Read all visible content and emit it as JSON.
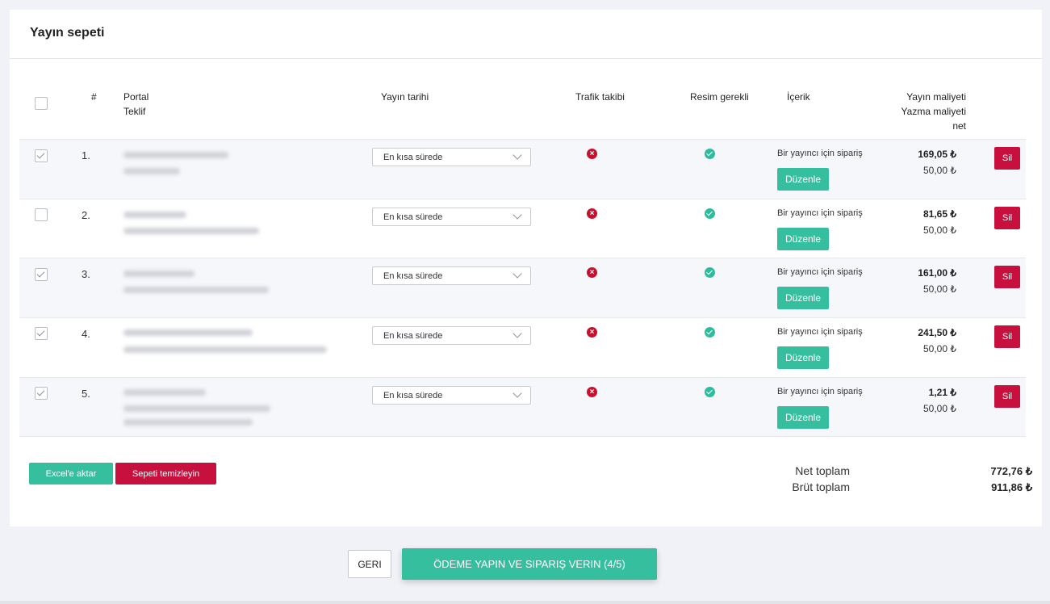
{
  "card": {
    "title": "Yayın sepeti"
  },
  "headers": {
    "number": "#",
    "portal": "Portal",
    "offer": "Teklif",
    "publish_date": "Yayın tarihi",
    "traffic": "Trafik takibi",
    "image": "Resim gerekli",
    "content": "İçerik",
    "publish_cost": "Yayın maliyeti",
    "write_cost": "Yazma maliyeti",
    "net": "net"
  },
  "rows": [
    {
      "num": "1.",
      "checked": true,
      "date": "En kısa sürede",
      "content": "Bir yayıncı için sipariş",
      "edit": "Düzenle",
      "price": "169,05 ₺",
      "write": "50,00 ₺",
      "delete": "Sil"
    },
    {
      "num": "2.",
      "checked": false,
      "date": "En kısa sürede",
      "content": "Bir yayıncı için sipariş",
      "edit": "Düzenle",
      "price": "81,65 ₺",
      "write": "50,00 ₺",
      "delete": "Sil"
    },
    {
      "num": "3.",
      "checked": true,
      "date": "En kısa sürede",
      "content": "Bir yayıncı için sipariş",
      "edit": "Düzenle",
      "price": "161,00 ₺",
      "write": "50,00 ₺",
      "delete": "Sil"
    },
    {
      "num": "4.",
      "checked": true,
      "date": "En kısa sürede",
      "content": "Bir yayıncı için sipariş",
      "edit": "Düzenle",
      "price": "241,50 ₺",
      "write": "50,00 ₺",
      "delete": "Sil"
    },
    {
      "num": "5.",
      "checked": true,
      "date": "En kısa sürede",
      "content": "Bir yayıncı için sipariş",
      "edit": "Düzenle",
      "price": "1,21 ₺",
      "write": "50,00 ₺",
      "delete": "Sil"
    }
  ],
  "actions": {
    "excel": "Excel'e aktar",
    "clear": "Sepeti temizleyin"
  },
  "totals": {
    "net_label": "Net toplam",
    "net_value": "772,76 ₺",
    "gross_label": "Brüt toplam",
    "gross_value": "911,86 ₺"
  },
  "footer": {
    "back": "GERI",
    "pay": "ÖDEME YAPIN VE SIPARIŞ VERIN (4/5)"
  },
  "colors": {
    "accent": "#35bf9f",
    "danger": "#c8103e",
    "error_icon": "#c8102e",
    "ok_icon": "#2dbd9c"
  }
}
